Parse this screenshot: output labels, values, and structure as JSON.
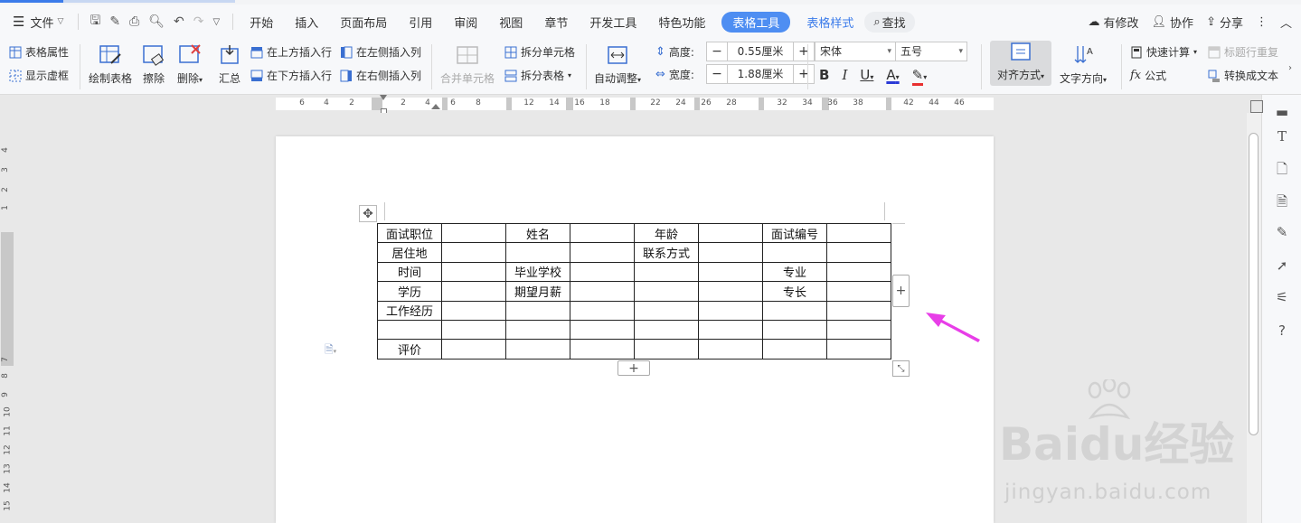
{
  "menu": {
    "file": "文件",
    "tabs": [
      "开始",
      "插入",
      "页面布局",
      "引用",
      "审阅",
      "视图",
      "章节",
      "开发工具",
      "特色功能"
    ],
    "active_tab": "表格工具",
    "table_style_tab": "表格样式",
    "search": "查找",
    "right": {
      "modified": "有修改",
      "collab": "协作",
      "share": "分享"
    }
  },
  "ribbon": {
    "table_props": "表格属性",
    "show_gridlines": "显示虚框",
    "draw_table": "绘制表格",
    "erase": "擦除",
    "delete": "删除",
    "summary": "汇总",
    "insert_above": "在上方插入行",
    "insert_below": "在下方插入行",
    "insert_left": "在左侧插入列",
    "insert_right": "在右侧插入列",
    "merge_cells": "合并单元格",
    "split_cells": "拆分单元格",
    "split_table": "拆分表格",
    "auto_fit": "自动调整",
    "height_label": "高度:",
    "height_value": "0.55厘米",
    "width_label": "宽度:",
    "width_value": "1.88厘米",
    "font_name": "宋体",
    "font_size": "五号",
    "bold": "B",
    "italic": "I",
    "underline": "U",
    "font_color": "A",
    "align": "对齐方式",
    "text_direction": "文字方向",
    "quick_calc": "快速计算",
    "repeat_header": "标题行重复",
    "formula": "公式",
    "to_text": "转换成文本"
  },
  "ruler": {
    "h_labels": [
      "6",
      "4",
      "2",
      "2",
      "4",
      "6",
      "8",
      "12",
      "14",
      "16",
      "18",
      "22",
      "24",
      "26",
      "28",
      "32",
      "34",
      "36",
      "38",
      "42",
      "44",
      "46"
    ],
    "v_labels": [
      "4",
      "3",
      "2",
      "1",
      "7",
      "8",
      "9",
      "10",
      "11",
      "12",
      "13",
      "14",
      "15"
    ]
  },
  "table": {
    "rows": [
      [
        "面试职位",
        "",
        "姓名",
        "",
        "年龄",
        "",
        "面试编号",
        ""
      ],
      [
        "居住地",
        "",
        "",
        "",
        "联系方式",
        "",
        "",
        ""
      ],
      [
        "时间",
        "",
        "毕业学校",
        "",
        "",
        "",
        "专业",
        ""
      ],
      [
        "学历",
        "",
        "期望月薪",
        "",
        "",
        "",
        "专长",
        ""
      ],
      [
        "工作经历",
        "",
        "",
        "",
        "",
        "",
        "",
        ""
      ],
      [
        "",
        "",
        "",
        "",
        "",
        "",
        "",
        ""
      ],
      [
        "评价",
        "",
        "",
        "",
        "",
        "",
        "",
        ""
      ]
    ]
  },
  "watermark": {
    "brand": "Baidu经验",
    "url": "jingyan.baidu.com"
  },
  "colors": {
    "accent": "#4e8ef2",
    "arrow": "#e83ee8"
  }
}
